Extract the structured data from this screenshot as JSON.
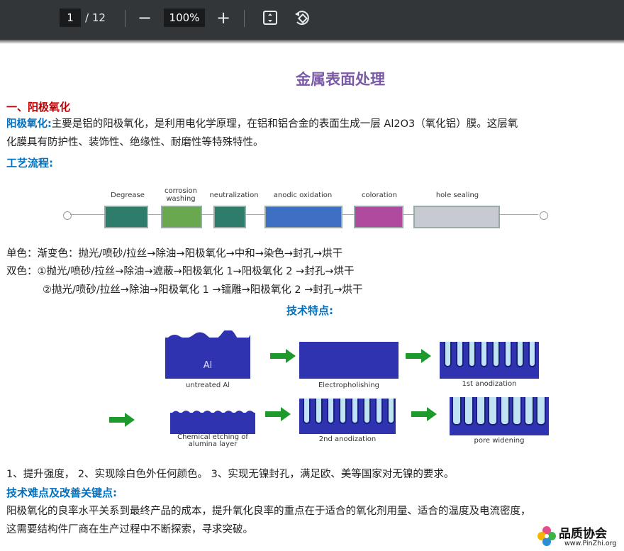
{
  "toolbar": {
    "page_current": "1",
    "page_total": "/ 12",
    "zoom_out": "−",
    "zoom": "100%",
    "zoom_in": "+"
  },
  "doc": {
    "title": "金属表面处理",
    "section1": "一、阳极氧化",
    "intro_label": "阳极氧化:",
    "intro_text_1": "主要是铝的阳极氧化，是利用电化学原理，在铝和铝合金的表面生成一层 Al2O3（氧化铝）膜。这层氧",
    "intro_text_2": "化膜具有防护性、装饰性、绝缘性、耐磨性等特殊特性。",
    "process_heading": "工艺流程:",
    "process_steps": [
      "Degrease",
      "corrosion\nwashing",
      "neutralization",
      "anodic oxidation",
      "coloration",
      "hole sealing"
    ],
    "single_color": "单色：渐变色：抛光/喷砂/拉丝→除油→阳极氧化→中和→染色→封孔→烘干",
    "double_color_1": "双色：①抛光/喷砂/拉丝→除油→遮蔽→阳极氧化 1→阳极氧化 2 →封孔→烘干",
    "double_color_2": "②抛光/喷砂/拉丝→除油→阳极氧化 1 →镭雕→阳极氧化 2 →封孔→烘干",
    "features_heading": "技术特点:",
    "fig_labels": {
      "al": "Al",
      "untreated": "untreated Al",
      "electropolishing": "Electropholishing",
      "first_anod": "1st anodization",
      "chemical_etching": "Chemical etching of\nalumina layer",
      "second_anod": "2nd anodization",
      "pore_widening": "pore widening"
    },
    "features_text": "1、提升强度，  2、实现除白色外任何颜色。    3、实现无镍封孔，满足欧、美等国家对无镍的要求。",
    "difficulty_heading": "技术难点及改善关键点:",
    "difficulty_text_1": "阳极氧化的良率水平关系到最终产品的成本，提升氧化良率的重点在于适合的氧化剂用量、适合的温度及电流密度，",
    "difficulty_text_2": "这需要结构件厂商在生产过程中不断探索，寻求突破。"
  },
  "logo": {
    "name": "品质协会",
    "url": "www.PinZhi.org"
  },
  "colors": {
    "toolbar_bg": "#323639",
    "title": "#7b5aa6",
    "heading_red": "#c00000",
    "heading_blue": "#0070c0",
    "alumina_blue": "#2f33b0",
    "arrow_green": "#1e9a2c"
  },
  "icons": [
    "fit-page-icon",
    "rotate-icon"
  ]
}
